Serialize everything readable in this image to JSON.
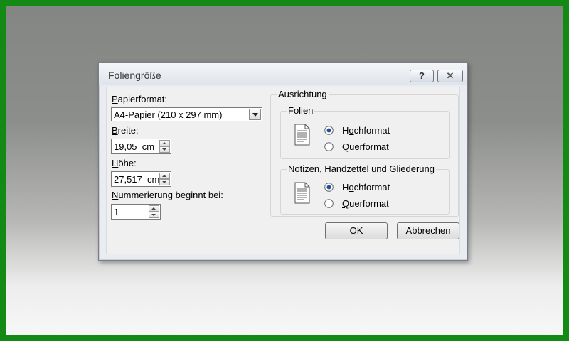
{
  "dialog": {
    "title": "Foliengröße",
    "help_button": "?",
    "close_button": "✕"
  },
  "left": {
    "paper_label": "Papierformat:",
    "paper_value": "A4-Papier (210 x 297 mm)",
    "width_label": "Breite:",
    "width_value": "19,05  cm",
    "height_label": "Höhe:",
    "height_value": "27,517  cm",
    "numbering_label": "Nummerierung beginnt bei:",
    "numbering_value": "1"
  },
  "orientation": {
    "title": "Ausrichtung",
    "slides": {
      "title": "Folien",
      "portrait": "Hochformat",
      "landscape": "Querformat",
      "selected": "portrait"
    },
    "notes": {
      "title": "Notizen, Handzettel und Gliederung",
      "portrait": "Hochformat",
      "landscape": "Querformat",
      "selected": "portrait"
    }
  },
  "buttons": {
    "ok": "OK",
    "cancel": "Abbrechen"
  }
}
